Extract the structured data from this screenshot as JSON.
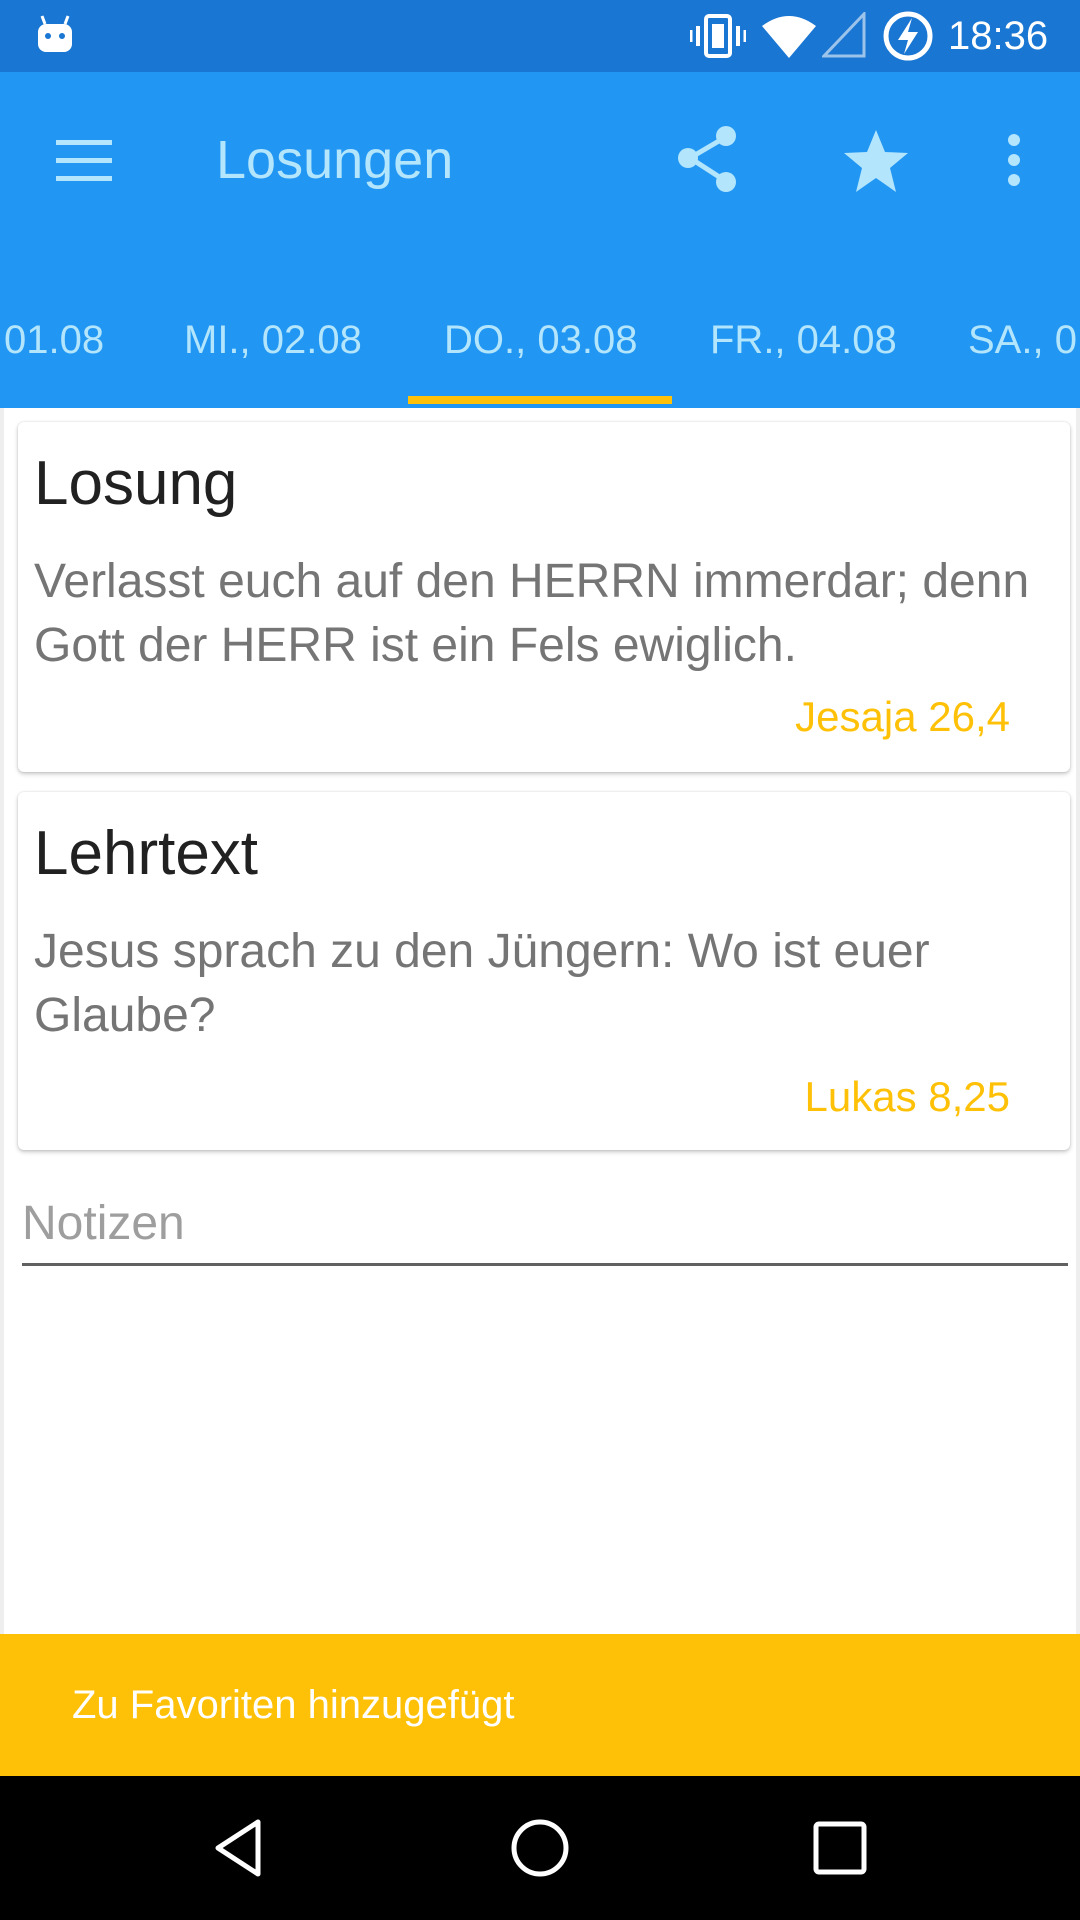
{
  "status_bar": {
    "time": "18:36",
    "icons": [
      "android-notification-icon",
      "vibrate-icon",
      "wifi-icon",
      "signal-icon",
      "battery-charging-icon"
    ]
  },
  "app_bar": {
    "title": "Losungen",
    "actions": [
      "menu-icon",
      "share-icon",
      "star-icon",
      "more-vert-icon"
    ],
    "background_color": "#2196F3",
    "title_color": "#B3E5FC"
  },
  "tabs": {
    "items": [
      {
        "label": "01.08"
      },
      {
        "label": "MI., 02.08"
      },
      {
        "label": "DO., 03.08"
      },
      {
        "label": "FR., 04.08"
      },
      {
        "label": "SA., 0"
      }
    ],
    "selected_index": 2,
    "indicator_color": "#FFC107"
  },
  "cards": {
    "losung": {
      "title": "Losung",
      "text": "Verlasst euch auf den HERRN immerdar; denn Gott der HERR ist ein Fels ewiglich.",
      "reference": "Jesaja 26,4"
    },
    "lehrtext": {
      "title": "Lehrtext",
      "text": "Jesus sprach zu den Jüngern: Wo ist euer Glaube?",
      "reference": "Lukas 8,25"
    },
    "reference_color": "#FFC107"
  },
  "notes": {
    "placeholder": "Notizen",
    "value": ""
  },
  "snackbar": {
    "message": "Zu Favoriten hinzugefügt",
    "background_color": "#FFC107"
  },
  "nav_bar": {
    "buttons": [
      "back-icon",
      "home-icon",
      "recents-icon"
    ]
  }
}
